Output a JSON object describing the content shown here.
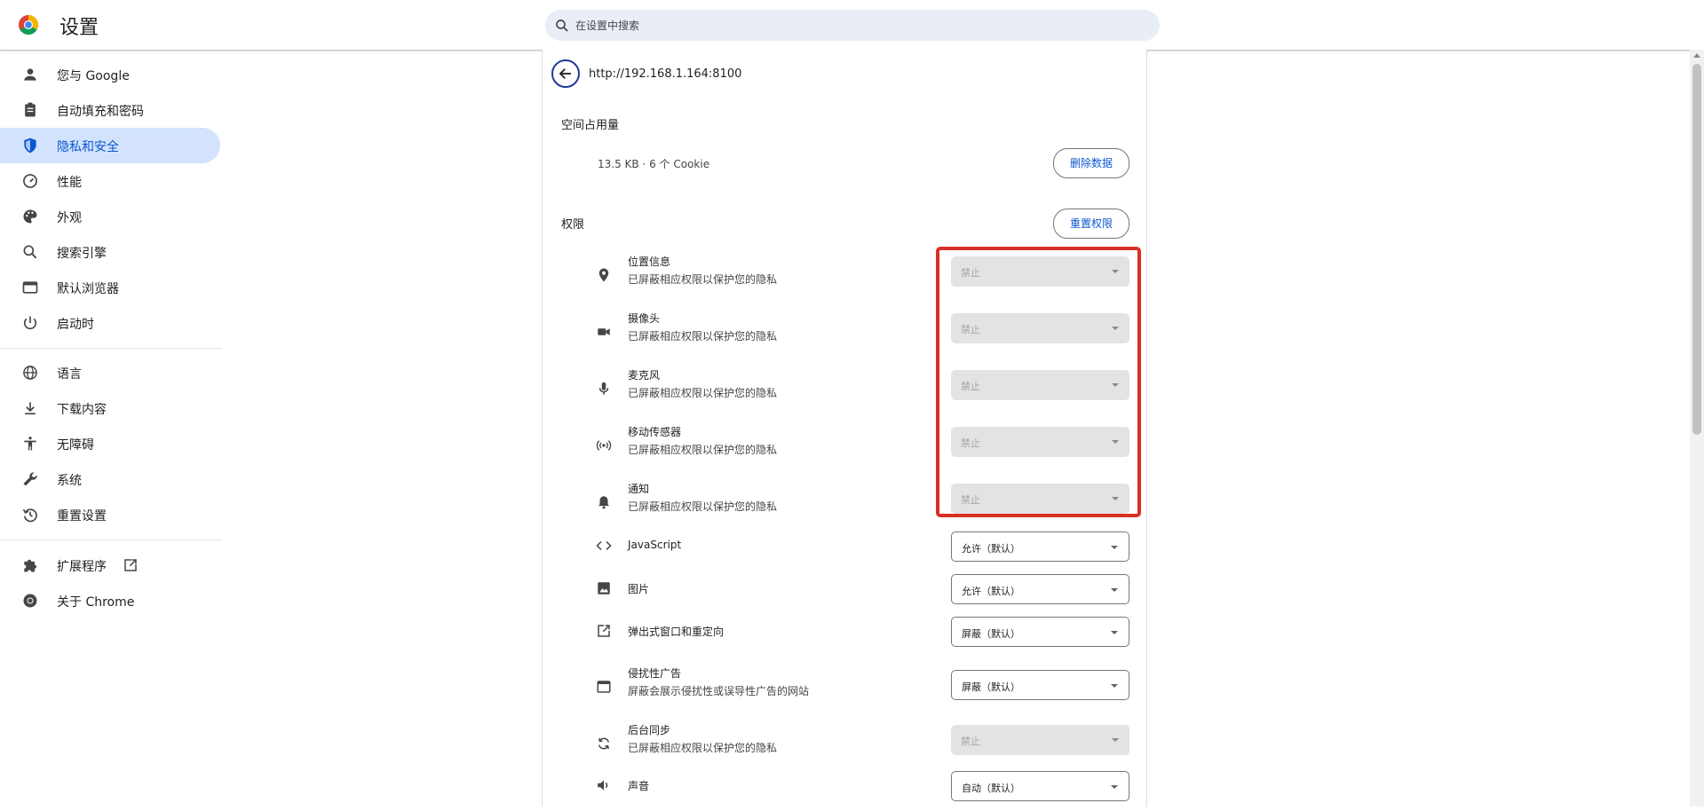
{
  "header": {
    "title": "设置",
    "search_placeholder": "在设置中搜索"
  },
  "sidebar": {
    "items": [
      {
        "label": "您与 Google",
        "icon": "person-icon"
      },
      {
        "label": "自动填充和密码",
        "icon": "clipboard-icon"
      },
      {
        "label": "隐私和安全",
        "icon": "shield-icon",
        "active": true
      },
      {
        "label": "性能",
        "icon": "speedometer-icon"
      },
      {
        "label": "外观",
        "icon": "palette-icon"
      },
      {
        "label": "搜索引擎",
        "icon": "search-icon"
      },
      {
        "label": "默认浏览器",
        "icon": "browser-window-icon"
      },
      {
        "label": "启动时",
        "icon": "power-icon"
      },
      {
        "label": "语言",
        "icon": "globe-icon"
      },
      {
        "label": "下载内容",
        "icon": "download-icon"
      },
      {
        "label": "无障碍",
        "icon": "accessibility-icon"
      },
      {
        "label": "系统",
        "icon": "wrench-icon"
      },
      {
        "label": "重置设置",
        "icon": "history-icon"
      },
      {
        "label": "扩展程序",
        "icon": "puzzle-icon"
      },
      {
        "label": "关于 Chrome",
        "icon": "chrome-icon"
      }
    ]
  },
  "site": {
    "url": "http://192.168.1.164:8100",
    "usage_label": "空间占用量",
    "usage_value": "13.5 KB · 6 个 Cookie",
    "delete_button": "删除数据",
    "permissions_label": "权限",
    "reset_button": "重置权限"
  },
  "permissions": [
    {
      "title": "位置信息",
      "subtitle": "已屏蔽相应权限以保护您的隐私",
      "value": "禁止",
      "disabled": true,
      "icon": "location-pin-icon"
    },
    {
      "title": "摄像头",
      "subtitle": "已屏蔽相应权限以保护您的隐私",
      "value": "禁止",
      "disabled": true,
      "icon": "camera-icon"
    },
    {
      "title": "麦克风",
      "subtitle": "已屏蔽相应权限以保护您的隐私",
      "value": "禁止",
      "disabled": true,
      "icon": "microphone-icon"
    },
    {
      "title": "移动传感器",
      "subtitle": "已屏蔽相应权限以保护您的隐私",
      "value": "禁止",
      "disabled": true,
      "icon": "sensors-icon"
    },
    {
      "title": "通知",
      "subtitle": "已屏蔽相应权限以保护您的隐私",
      "value": "禁止",
      "disabled": true,
      "icon": "bell-icon"
    },
    {
      "title": "JavaScript",
      "subtitle": "",
      "value": "允许（默认）",
      "disabled": false,
      "icon": "code-icon"
    },
    {
      "title": "图片",
      "subtitle": "",
      "value": "允许（默认）",
      "disabled": false,
      "icon": "image-icon"
    },
    {
      "title": "弹出式窗口和重定向",
      "subtitle": "",
      "value": "屏蔽（默认）",
      "disabled": false,
      "icon": "open-in-new-icon"
    },
    {
      "title": "侵扰性广告",
      "subtitle": "屏蔽会展示侵扰性或误导性广告的网站",
      "value": "屏蔽（默认）",
      "disabled": false,
      "icon": "ad-window-icon"
    },
    {
      "title": "后台同步",
      "subtitle": "已屏蔽相应权限以保护您的隐私",
      "value": "禁止",
      "disabled": true,
      "icon": "sync-icon"
    },
    {
      "title": "声音",
      "subtitle": "",
      "value": "自动（默认）",
      "disabled": false,
      "icon": "speaker-icon"
    }
  ],
  "colors": {
    "accent": "#0b57d0",
    "active_nav_bg": "#d3e3fd",
    "highlight_border": "#d93025",
    "disabled_select_bg": "#e3e3e3"
  }
}
